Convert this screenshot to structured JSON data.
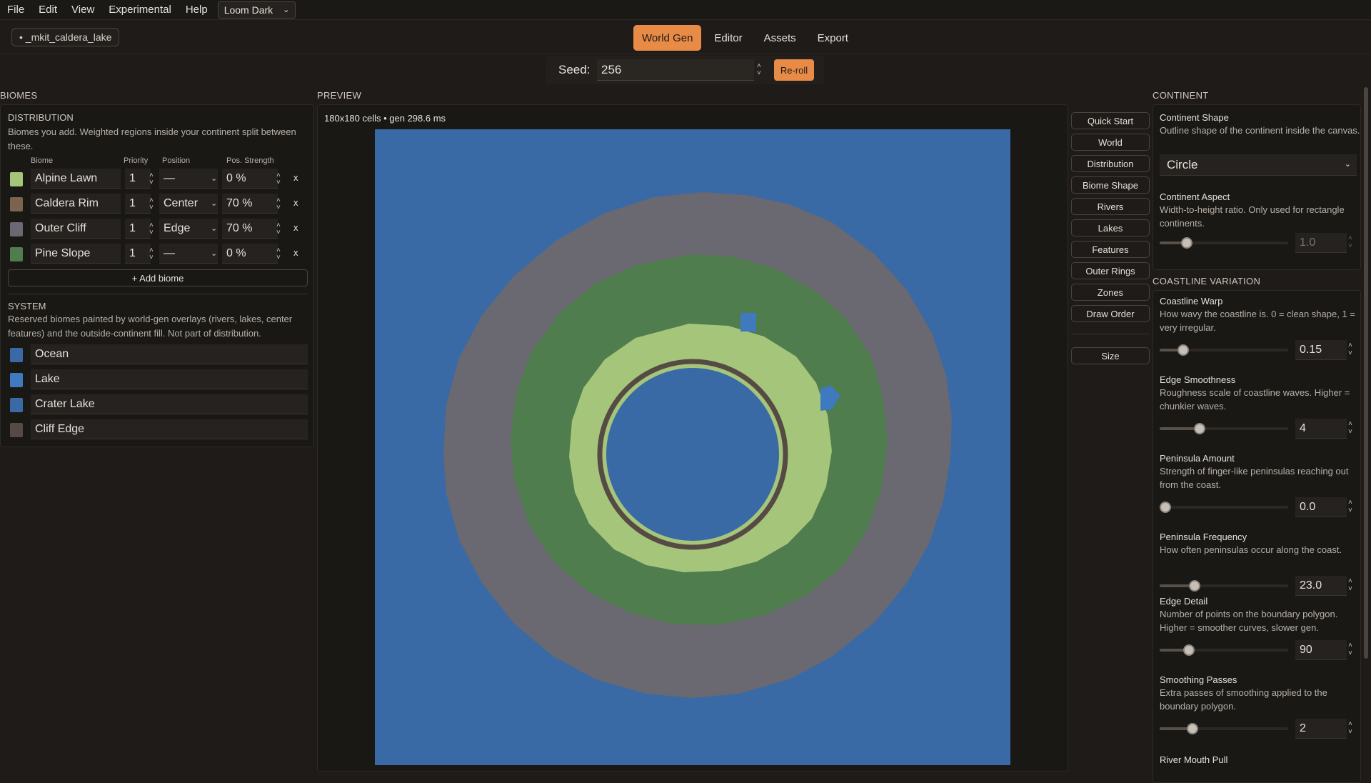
{
  "menubar": {
    "items": [
      "File",
      "Edit",
      "View",
      "Experimental",
      "Help"
    ],
    "theme": "Loom Dark"
  },
  "toolbar": {
    "file_name": "• _mkit_caldera_lake",
    "tabs": [
      "World Gen",
      "Editor",
      "Assets",
      "Export"
    ],
    "active_tab": "World Gen"
  },
  "seed": {
    "label": "Seed:",
    "value": "256",
    "reroll_label": "Re-roll"
  },
  "biomes": {
    "section_title": "BIOMES",
    "distribution_title": "DISTRIBUTION",
    "distribution_desc": "Biomes you add. Weighted regions inside your continent split between these.",
    "columns": [
      "Biome",
      "Priority",
      "Position",
      "Pos. Strength"
    ],
    "rows": [
      {
        "name": "Alpine Lawn",
        "priority": "1",
        "position": "—",
        "strength": "0 %",
        "color": "#a4c57a"
      },
      {
        "name": "Caldera Rim",
        "priority": "1",
        "position": "Center",
        "strength": "70 %",
        "color": "#7a6450"
      },
      {
        "name": "Outer Cliff",
        "priority": "1",
        "position": "Edge",
        "strength": "70 %",
        "color": "#6a6870"
      },
      {
        "name": "Pine Slope",
        "priority": "1",
        "position": "—",
        "strength": "0 %",
        "color": "#4f7d4e"
      }
    ],
    "remove_label": "x",
    "add_label": "+ Add biome",
    "system_title": "SYSTEM",
    "system_desc": "Reserved biomes painted by world-gen overlays (rivers, lakes, center features) and the outside-continent fill. Not part of distribution.",
    "system_rows": [
      {
        "name": "Ocean",
        "color": "#3a6aa6"
      },
      {
        "name": "Lake",
        "color": "#3f79be"
      },
      {
        "name": "Crater Lake",
        "color": "#3a6aa6"
      },
      {
        "name": "Cliff Edge",
        "color": "#564a44"
      }
    ]
  },
  "preview": {
    "section_title": "PREVIEW",
    "info": "180x180 cells • gen 298.6 ms",
    "map_colors": {
      "ocean": "#3a6aa6",
      "outer_cliff": "#6a6870",
      "pine_slope": "#4f7d4e",
      "alpine_lawn": "#a4c57a",
      "caldera_rim": "#564a44",
      "lake": "#3f79be"
    }
  },
  "nav": {
    "buttons": [
      "Quick Start",
      "World",
      "Distribution",
      "Biome Shape",
      "Rivers",
      "Lakes",
      "Features",
      "Outer Rings",
      "Zones",
      "Draw Order"
    ],
    "size_label": "Size"
  },
  "continent": {
    "section_title": "CONTINENT",
    "shape_title": "Continent Shape",
    "shape_desc": "Outline shape of the continent inside the canvas.",
    "shape_value": "Circle",
    "aspect_title": "Continent Aspect",
    "aspect_desc": "Width-to-height ratio. Only used for rectangle continents.",
    "aspect_value": "1.0",
    "aspect_fraction": 0.18
  },
  "coastline": {
    "section_title": "COASTLINE VARIATION",
    "params": [
      {
        "title": "Coastline Warp",
        "desc": "How wavy the coastline is. 0 = clean shape, 1 = very irregular.",
        "value": "0.15",
        "fraction": 0.15
      },
      {
        "title": "Edge Smoothness",
        "desc": "Roughness scale of coastline waves. Higher = chunkier waves.",
        "value": "4",
        "fraction": 0.29
      },
      {
        "title": "Peninsula Amount",
        "desc": "Strength of finger-like peninsulas reaching out from the coast.",
        "value": "0.0",
        "fraction": 0.0
      },
      {
        "title": "Peninsula Frequency",
        "desc": "How often peninsulas occur along the coast.",
        "value": "23.0",
        "fraction": 0.25
      },
      {
        "title": "Edge Detail",
        "desc": "Number of points on the boundary polygon. Higher = smoother curves, slower gen.",
        "value": "90",
        "fraction": 0.2
      },
      {
        "title": "Smoothing Passes",
        "desc": "Extra passes of smoothing applied to the boundary polygon.",
        "value": "2",
        "fraction": 0.23
      }
    ],
    "next_title": "River Mouth Pull"
  }
}
